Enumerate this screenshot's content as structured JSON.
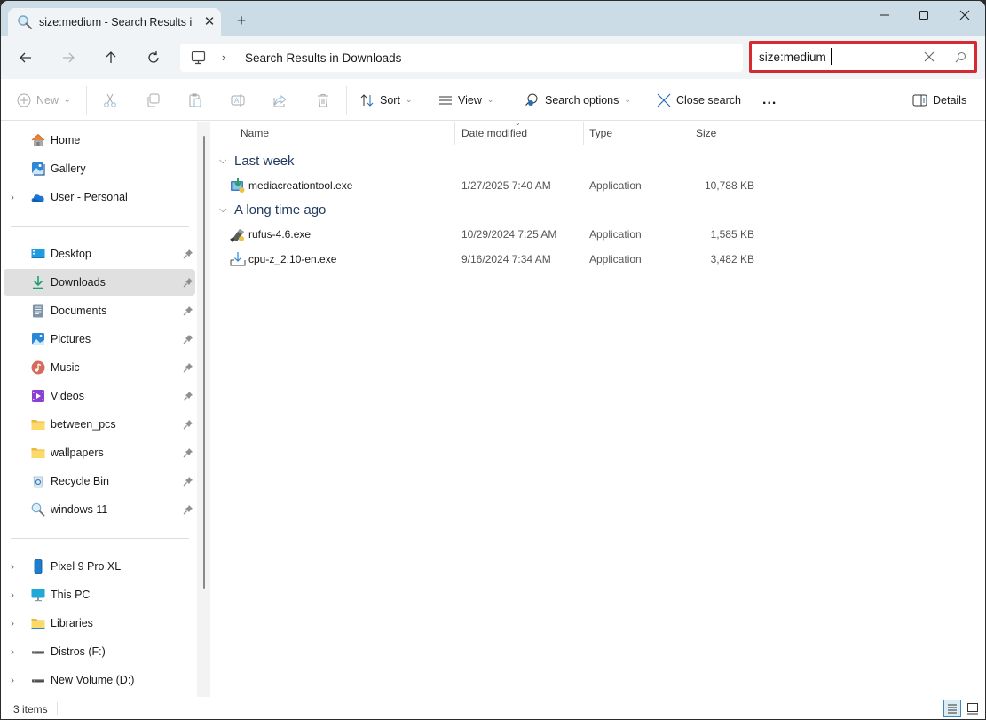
{
  "window": {
    "tab_title": "size:medium - Search Results i",
    "controls": {
      "minimize": "minimize",
      "maximize": "maximize",
      "close": "close"
    }
  },
  "address_bar": {
    "root_icon": "this-pc-icon",
    "crumb": "Search Results in Downloads"
  },
  "search": {
    "value": "size:medium",
    "placeholder": ""
  },
  "commands": {
    "new": "New",
    "sort": "Sort",
    "view": "View",
    "search_options": "Search options",
    "close_search": "Close search",
    "more": "...",
    "details": "Details"
  },
  "sidebar": {
    "top": [
      {
        "label": "Home",
        "icon": "home-icon",
        "expandable": false
      },
      {
        "label": "Gallery",
        "icon": "gallery-icon",
        "expandable": false
      },
      {
        "label": "User - Personal",
        "icon": "onedrive-icon",
        "expandable": true
      }
    ],
    "pinned": [
      {
        "label": "Desktop",
        "icon": "desktop-icon"
      },
      {
        "label": "Downloads",
        "icon": "downloads-icon",
        "selected": true
      },
      {
        "label": "Documents",
        "icon": "documents-icon"
      },
      {
        "label": "Pictures",
        "icon": "pictures-icon"
      },
      {
        "label": "Music",
        "icon": "music-icon"
      },
      {
        "label": "Videos",
        "icon": "videos-icon"
      },
      {
        "label": "between_pcs",
        "icon": "folder-icon"
      },
      {
        "label": "wallpapers",
        "icon": "folder-icon"
      },
      {
        "label": "Recycle Bin",
        "icon": "recycle-bin-icon"
      },
      {
        "label": "windows 11",
        "icon": "search-icon"
      }
    ],
    "devices": [
      {
        "label": "Pixel 9 Pro XL",
        "icon": "phone-icon"
      },
      {
        "label": "This PC",
        "icon": "this-pc-icon"
      },
      {
        "label": "Libraries",
        "icon": "libraries-icon"
      },
      {
        "label": "Distros (F:)",
        "icon": "drive-icon"
      },
      {
        "label": "New Volume (D:)",
        "icon": "drive-icon"
      }
    ]
  },
  "columns": {
    "name": "Name",
    "date": "Date modified",
    "type": "Type",
    "size": "Size"
  },
  "groups": [
    {
      "label": "Last week",
      "files": [
        {
          "name": "mediacreationtool.exe",
          "date": "1/27/2025 7:40 AM",
          "type": "Application",
          "size": "10,788 KB",
          "icon": "media-creation-tool-icon"
        }
      ]
    },
    {
      "label": "A long time ago",
      "files": [
        {
          "name": "rufus-4.6.exe",
          "date": "10/29/2024 7:25 AM",
          "type": "Application",
          "size": "1,585 KB",
          "icon": "rufus-icon"
        },
        {
          "name": "cpu-z_2.10-en.exe",
          "date": "9/16/2024 7:34 AM",
          "type": "Application",
          "size": "3,482 KB",
          "icon": "installer-icon"
        }
      ]
    }
  ],
  "status": {
    "count": "3 items",
    "view_mode": "details"
  },
  "colors": {
    "titlebar": "#cbdce6",
    "search_highlight": "#d42a32",
    "group_header": "#1e3a5f",
    "selected_nav": "#e0e0e0"
  }
}
